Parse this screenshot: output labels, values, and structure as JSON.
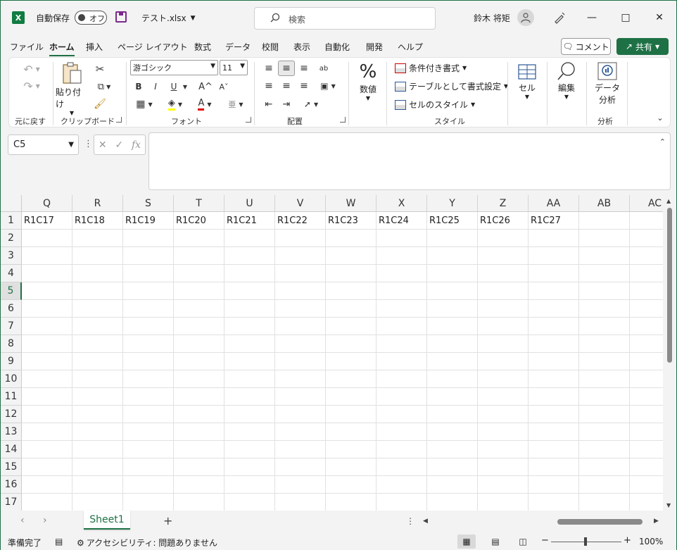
{
  "titlebar": {
    "logo": "X",
    "autosave_label": "自動保存",
    "autosave_state": "オフ",
    "filename": "テスト.xlsx",
    "search_placeholder": "検索",
    "username": "鈴木 将矩"
  },
  "menu": [
    "ファイル",
    "ホーム",
    "挿入",
    "ページ レイアウト",
    "数式",
    "データ",
    "校閲",
    "表示",
    "自動化",
    "開発",
    "ヘルプ"
  ],
  "menu_active": "ホーム",
  "comment_label": "コメント",
  "share_label": "共有",
  "ribbon": {
    "undo_group": "元に戻す",
    "paste_label": "貼り付け",
    "clipboard_group": "クリップボード",
    "font_name": "游ゴシック",
    "font_size": "11",
    "bold": "B",
    "italic": "I",
    "underline": "U",
    "grow": "A^",
    "shrink": "Aˇ",
    "font_group": "フォント",
    "align_group": "配置",
    "number_label": "数値",
    "number_symbol": "%",
    "conditional_format": "条件付き書式",
    "table_format": "テーブルとして書式設定",
    "cell_styles": "セルのスタイル",
    "styles_group": "スタイル",
    "cells_label": "セル",
    "edit_label": "編集",
    "analysis_label_1": "データ",
    "analysis_label_2": "分析",
    "analysis_group": "分析"
  },
  "namebox": "C5",
  "fx_label": "fx",
  "columns": [
    "Q",
    "R",
    "S",
    "T",
    "U",
    "V",
    "W",
    "X",
    "Y",
    "Z",
    "AA",
    "AB",
    "AC"
  ],
  "rows": [
    "1",
    "2",
    "3",
    "4",
    "5",
    "6",
    "7",
    "8",
    "9",
    "10",
    "11",
    "12",
    "13",
    "14",
    "15",
    "16",
    "17"
  ],
  "row1_values": [
    "R1C17",
    "R1C18",
    "R1C19",
    "R1C20",
    "R1C21",
    "R1C22",
    "R1C23",
    "R1C24",
    "R1C25",
    "R1C26",
    "R1C27",
    "",
    ""
  ],
  "selected_row": "5",
  "sheet_name": "Sheet1",
  "status": {
    "ready": "準備完了",
    "accessibility": "アクセシビリティ: 問題ありません",
    "zoom": "100%"
  },
  "colors": {
    "accent": "#1e7145"
  }
}
